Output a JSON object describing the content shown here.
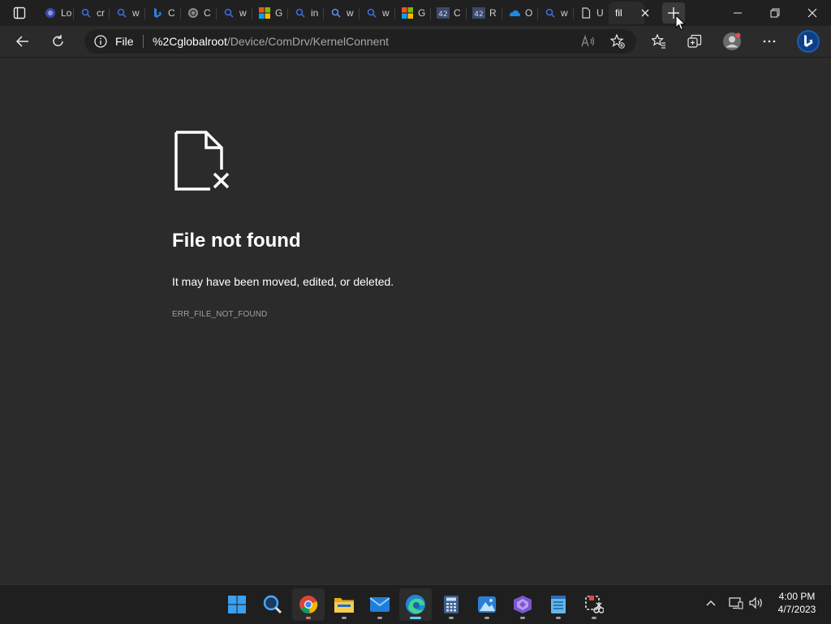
{
  "tabs": [
    {
      "title": "Lo",
      "icon": "blue-circle-icon"
    },
    {
      "title": "cr",
      "icon": "search-icon"
    },
    {
      "title": "w",
      "icon": "search-icon"
    },
    {
      "title": "C",
      "icon": "bing-icon"
    },
    {
      "title": "C",
      "icon": "openai-icon"
    },
    {
      "title": "w",
      "icon": "search-icon"
    },
    {
      "title": "G",
      "icon": "microsoft-logo-icon"
    },
    {
      "title": "in",
      "icon": "search-icon"
    },
    {
      "title": "w",
      "icon": "search-icon"
    },
    {
      "title": "w",
      "icon": "search-icon"
    },
    {
      "title": "G",
      "icon": "microsoft-logo-icon"
    },
    {
      "title": "C",
      "icon": "number-42-icon"
    },
    {
      "title": "R",
      "icon": "number-42-icon"
    },
    {
      "title": "O",
      "icon": "onedrive-icon"
    },
    {
      "title": "w",
      "icon": "search-icon"
    },
    {
      "title": "U",
      "icon": "page-icon"
    },
    {
      "title": "fil",
      "icon": "",
      "active": true
    }
  ],
  "address_bar": {
    "scheme_label": "File",
    "url_host": "%2Cglobalroot",
    "url_path": "/Device/ComDrv/KernelConnent"
  },
  "error_page": {
    "title": "File not found",
    "message": "It may have been moved, edited, or deleted.",
    "code": "ERR_FILE_NOT_FOUND"
  },
  "taskbar": {
    "apps": [
      "start",
      "search",
      "chrome",
      "file-explorer",
      "mail",
      "edge",
      "calculator",
      "photos",
      "visual-studio",
      "notepad",
      "snipping-tool"
    ],
    "active_app": "edge"
  },
  "clock": {
    "time": "4:00 PM",
    "date": "4/7/2023"
  },
  "colors": {
    "page_bg": "#2b2b2b",
    "tabstrip_bg": "#202020",
    "taskbar_bg": "#1f1f1f",
    "accent": "#60cdff"
  }
}
